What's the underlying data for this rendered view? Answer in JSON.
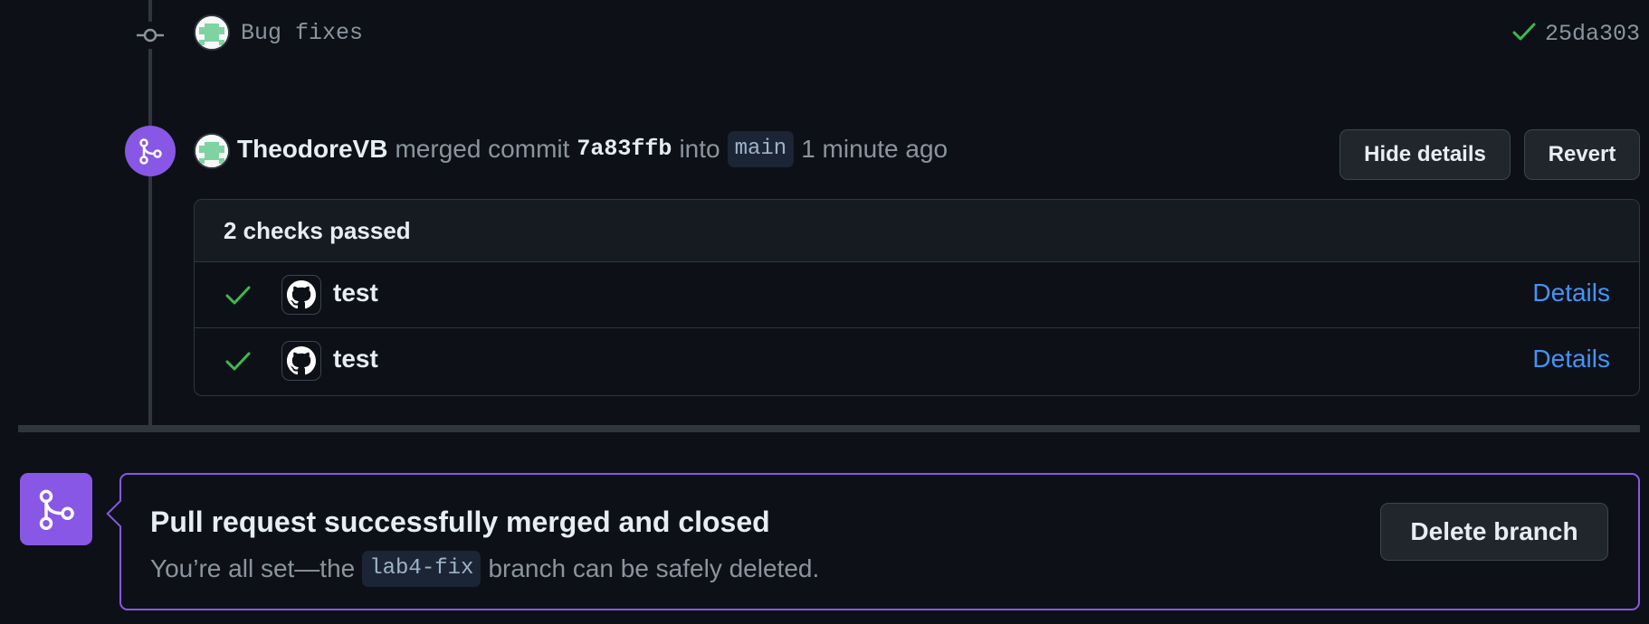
{
  "commit": {
    "message": "Bug fixes",
    "sha": "25da303",
    "status_icon": "check-icon"
  },
  "merge_event": {
    "user": "TheodoreVB",
    "action": "merged commit",
    "commit_sha": "7a83ffb",
    "into_word": "into",
    "target_branch": "main",
    "time": "1 minute ago",
    "hide_details_label": "Hide details",
    "revert_label": "Revert"
  },
  "checks": {
    "header": "2 checks passed",
    "items": [
      {
        "name": "test",
        "details_label": "Details",
        "status": "success"
      },
      {
        "name": "test",
        "details_label": "Details",
        "status": "success"
      }
    ]
  },
  "merged_notice": {
    "title": "Pull request successfully merged and closed",
    "sub_prefix": "You’re all set—the",
    "branch": "lab4-fix",
    "sub_suffix": "branch can be safely deleted.",
    "delete_label": "Delete branch"
  },
  "colors": {
    "background": "#0d1117",
    "merged_purple": "#8957e5",
    "success_green": "#3fb950",
    "link_blue": "#4493f8"
  }
}
